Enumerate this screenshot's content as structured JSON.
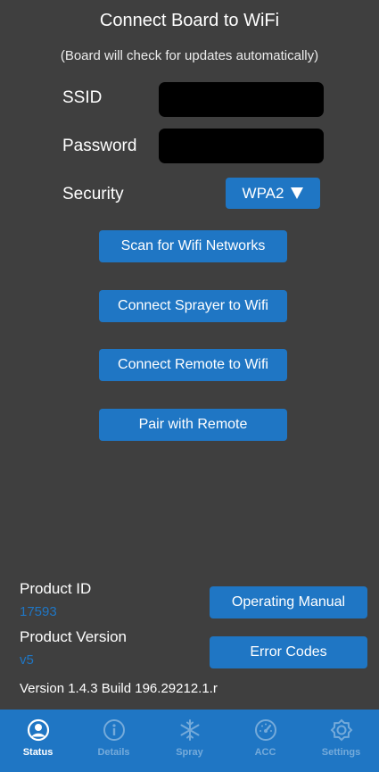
{
  "header": {
    "title": "Connect Board to WiFi",
    "subtitle": "(Board will check for updates automatically)"
  },
  "form": {
    "ssid_label": "SSID",
    "ssid_value": "",
    "password_label": "Password",
    "password_value": "",
    "security_label": "Security",
    "security_value": "WPA2"
  },
  "actions": {
    "scan": "Scan for Wifi Networks",
    "connect_sprayer": "Connect Sprayer to Wifi",
    "connect_remote": "Connect Remote to Wifi",
    "pair_remote": "Pair with Remote"
  },
  "product": {
    "id_label": "Product ID",
    "id_value": "17593",
    "version_label": "Product Version",
    "version_value": "v5",
    "manual_button": "Operating Manual",
    "error_codes_button": "Error Codes"
  },
  "app_version": "Version 1.4.3 Build 196.29212.1.r",
  "tabs": [
    {
      "label": "Status",
      "icon": "person-circle-icon",
      "active": true
    },
    {
      "label": "Details",
      "icon": "info-circle-icon",
      "active": false
    },
    {
      "label": "Spray",
      "icon": "snowflake-icon",
      "active": false
    },
    {
      "label": "ACC",
      "icon": "speedometer-icon",
      "active": false
    },
    {
      "label": "Settings",
      "icon": "gear-icon",
      "active": false
    }
  ],
  "colors": {
    "background": "#3f3f3f",
    "accent": "#1f76c4",
    "field": "#000000"
  }
}
